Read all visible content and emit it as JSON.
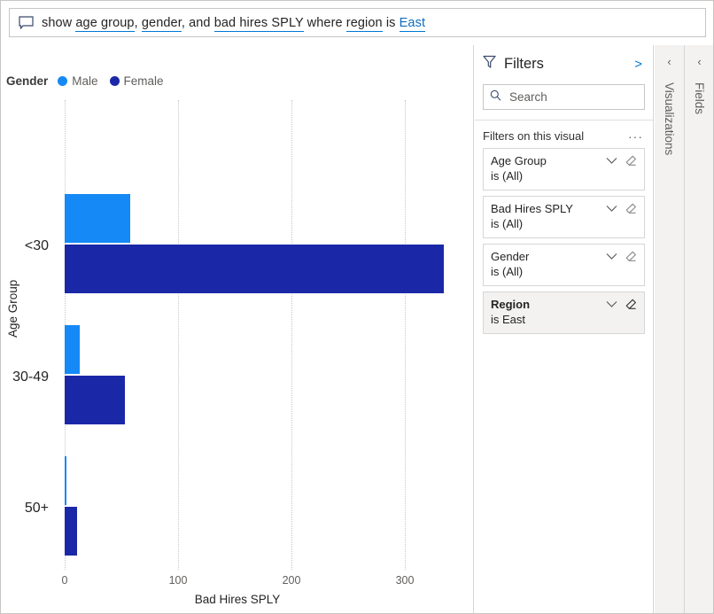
{
  "query_bar": {
    "icon": "comment-bubble-icon",
    "segments": [
      {
        "text": "show ",
        "type": "plain"
      },
      {
        "text": "age group",
        "type": "term"
      },
      {
        "text": ", ",
        "type": "plain"
      },
      {
        "text": "gender",
        "type": "term"
      },
      {
        "text": ", and ",
        "type": "plain"
      },
      {
        "text": "bad hires SPLY",
        "type": "term"
      },
      {
        "text": " where ",
        "type": "plain"
      },
      {
        "text": "region",
        "type": "term"
      },
      {
        "text": " is ",
        "type": "plain"
      },
      {
        "text": "East",
        "type": "value"
      }
    ],
    "full_text": "show age group, gender, and bad hires SPLY where region is East"
  },
  "legend": {
    "title": "Gender",
    "items": [
      {
        "label": "Male",
        "color": "#1589F5"
      },
      {
        "label": "Female",
        "color": "#1A28A8"
      }
    ]
  },
  "chart_data": {
    "type": "bar",
    "orientation": "horizontal",
    "title": "",
    "xlabel": "Bad Hires SPLY",
    "ylabel": "Age Group",
    "categories": [
      "<30",
      "30-49",
      "50+"
    ],
    "series": [
      {
        "name": "Male",
        "color": "#1589F5",
        "values": [
          58,
          13,
          1
        ]
      },
      {
        "name": "Female",
        "color": "#1A28A8",
        "values": [
          334,
          53,
          11
        ]
      }
    ],
    "xlim": [
      0,
      360
    ],
    "xticks": [
      0,
      100,
      200,
      300
    ],
    "xtick_labels": [
      "0",
      "100",
      "200",
      "300"
    ],
    "grid": true,
    "grid_style": "dotted-vertical",
    "legend_position": "top-left"
  },
  "filters_pane": {
    "title": "Filters",
    "funnel_icon": "funnel-icon",
    "expand_icon": ">",
    "search": {
      "placeholder": "Search",
      "value": "",
      "icon": "search-icon"
    },
    "section_label": "Filters on this visual",
    "more_label": "···",
    "cards": [
      {
        "name": "Age Group",
        "value": "is (All)",
        "active": false
      },
      {
        "name": "Bad Hires SPLY",
        "value": "is (All)",
        "active": false
      },
      {
        "name": "Gender",
        "value": "is (All)",
        "active": false
      },
      {
        "name": "Region",
        "value": "is East",
        "active": true
      }
    ]
  },
  "side_panes": [
    {
      "label": "Visualizations",
      "chevron": "‹"
    },
    {
      "label": "Fields",
      "chevron": "‹"
    }
  ]
}
